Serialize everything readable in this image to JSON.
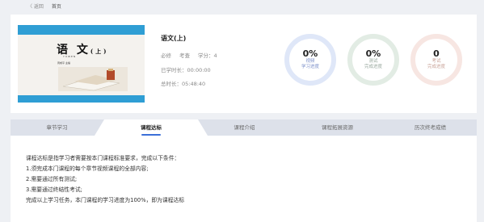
{
  "nav": {
    "back": "〈 返回",
    "home": "首页"
  },
  "course": {
    "cover": {
      "title": "语 文",
      "title_suffix": "(上)",
      "subtitle": "YUWEN",
      "editor": "周成平 主编"
    },
    "title": "语文(上)",
    "tags": [
      "必修",
      "考查",
      "学分：4"
    ],
    "study_time": "已学时长：00:00:00",
    "total_time": "总时长：05:48:40"
  },
  "stats": [
    {
      "value": "0%",
      "label_1": "视频",
      "label_2": "学习进度",
      "color": "#7b8fc9"
    },
    {
      "value": "0%",
      "label_1": "测试",
      "label_2": "完成进度",
      "color": "#98a89e"
    },
    {
      "value": "0",
      "label_1": "考试",
      "label_2": "完成进度",
      "color": "#c9a398"
    }
  ],
  "tabs": [
    {
      "label": "章节学习",
      "active": false
    },
    {
      "label": "课程达标",
      "active": true
    },
    {
      "label": "课程介绍",
      "active": false
    },
    {
      "label": "课程拓展资源",
      "active": false
    },
    {
      "label": "历次终考成绩",
      "active": false
    }
  ],
  "content": {
    "lines": [
      "课程达标是指学习者需要按本门课程标准要求，完成以下条件：",
      "1.须完成本门课程的每个章节视频课程的全部内容;",
      "2.需要通过所有测试;",
      "3.需要通过终结性考试;",
      "完成以上学习任务，本门课程的学习进度为100%，即为课程达标"
    ]
  },
  "colors": {
    "accent": "#3b6fd8",
    "background": "#eef0f4",
    "tab_bar": "#dde1ea"
  }
}
